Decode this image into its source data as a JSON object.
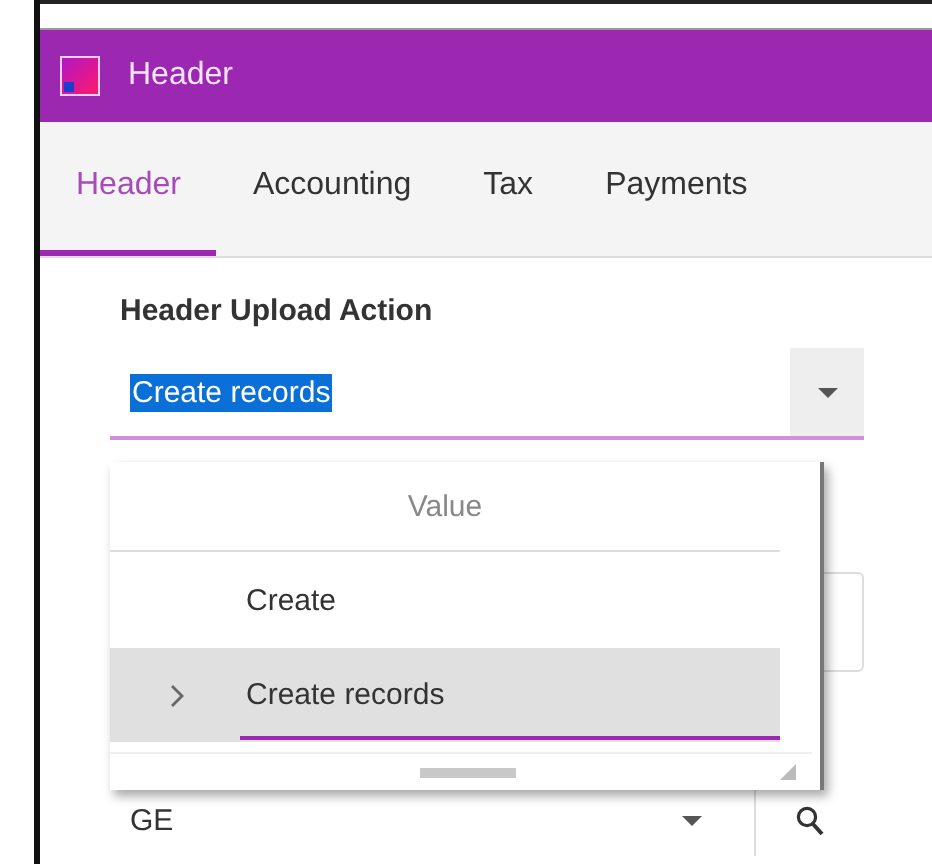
{
  "window": {
    "title": "Header"
  },
  "tabs": [
    {
      "label": "Header",
      "selected": true
    },
    {
      "label": "Accounting",
      "selected": false
    },
    {
      "label": "Tax",
      "selected": false
    },
    {
      "label": "Payments",
      "selected": false
    }
  ],
  "upload_action": {
    "label": "Header Upload Action",
    "value": "Create records",
    "text_highlighted": true
  },
  "dropdown": {
    "column": "Value",
    "options": [
      {
        "label": "Create",
        "selected": false
      },
      {
        "label": "Create records",
        "selected": true
      }
    ]
  },
  "filter": {
    "value": "GE"
  }
}
